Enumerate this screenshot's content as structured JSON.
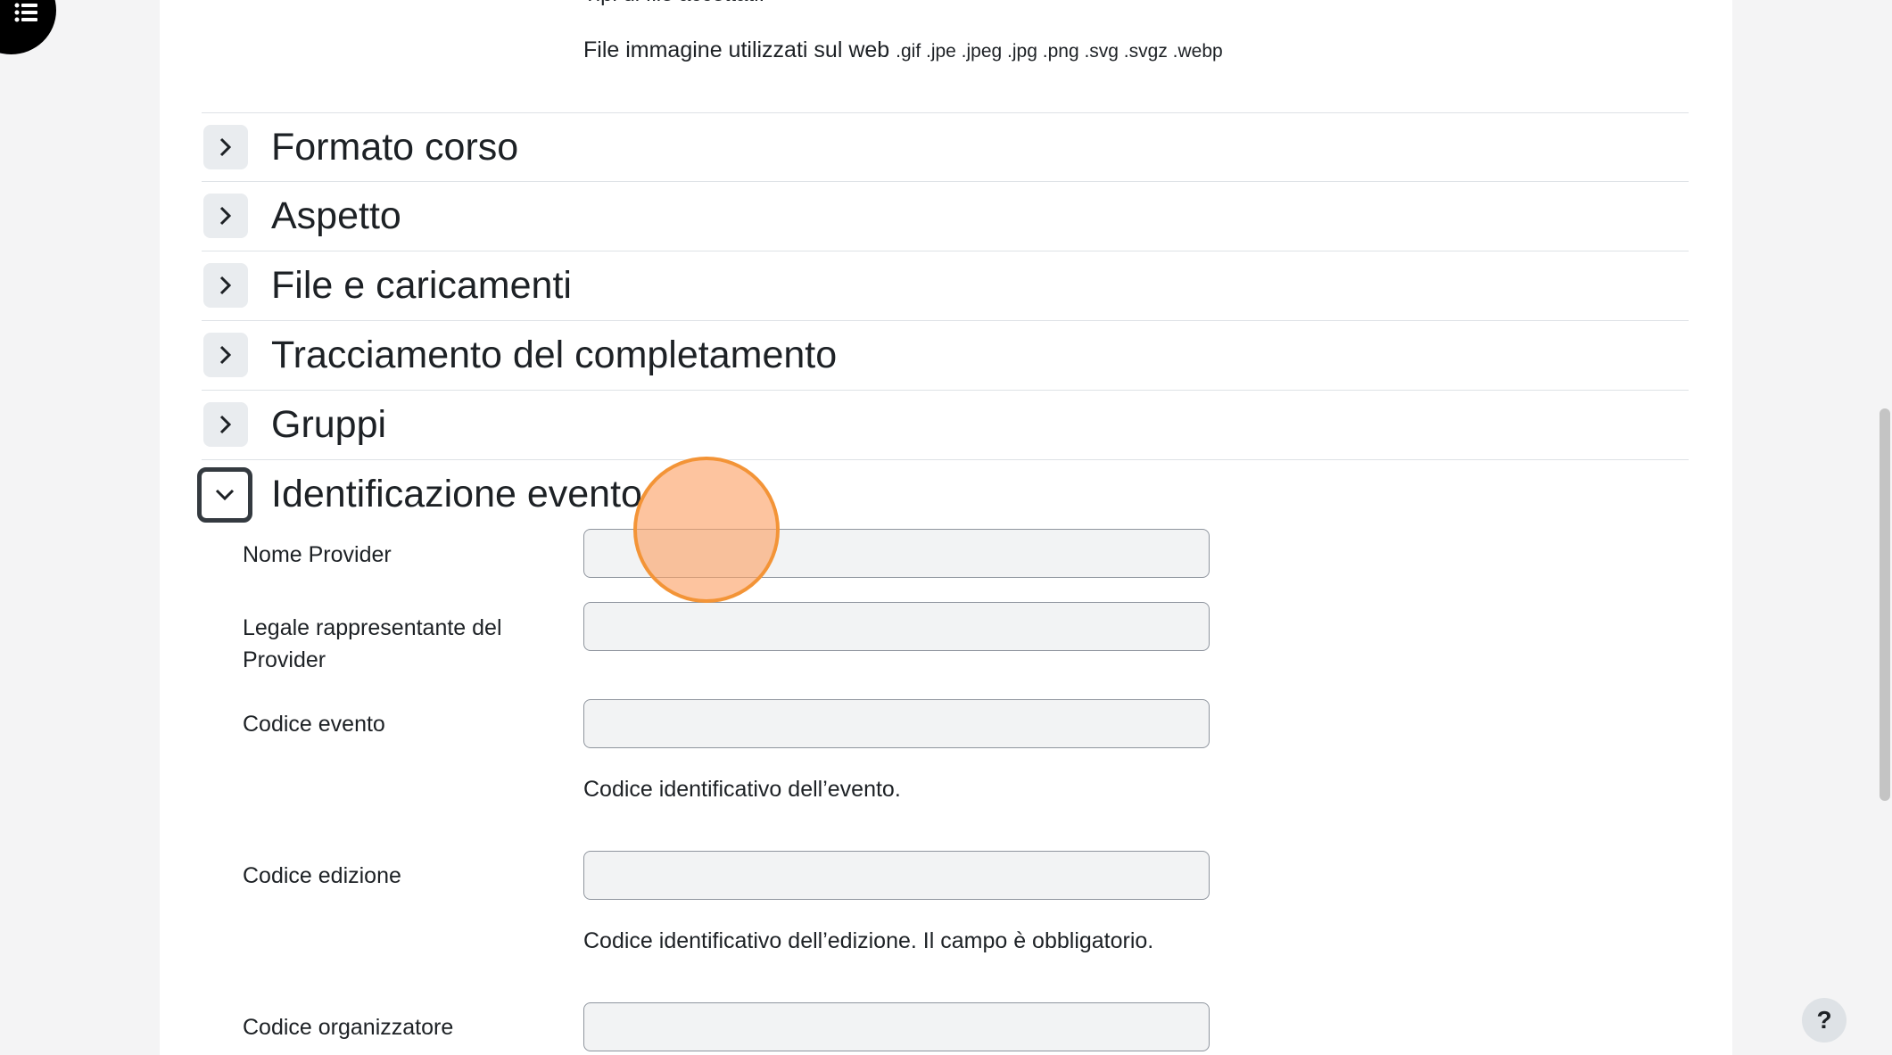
{
  "file_types": {
    "accepted_label": "Tipi di file accettati:",
    "web_images_label": "File immagine utilizzati sul web",
    "web_images_extensions": ".gif .jpe .jpeg .jpg .png .svg .svgz .webp"
  },
  "sections": [
    {
      "title": "Formato corso",
      "expanded": false
    },
    {
      "title": "Aspetto",
      "expanded": false
    },
    {
      "title": "File e caricamenti",
      "expanded": false
    },
    {
      "title": "Tracciamento del completamento",
      "expanded": false
    },
    {
      "title": "Gruppi",
      "expanded": false
    },
    {
      "title": "Identificazione evento",
      "expanded": true
    }
  ],
  "event_fields": {
    "provider_name": {
      "label": "Nome Provider",
      "value": ""
    },
    "legal_rep": {
      "label": "Legale rappresentante del Provider",
      "value": ""
    },
    "event_code": {
      "label": "Codice evento",
      "value": "",
      "help": "Codice identificativo dell’evento."
    },
    "edition_code": {
      "label": "Codice edizione",
      "value": "",
      "help": "Codice identificativo dell’edizione. Il campo è obbligatorio."
    },
    "organizer_code": {
      "label": "Codice organizzatore",
      "value": ""
    }
  },
  "help_button": {
    "label": "?"
  },
  "icons": {
    "drawer": "list-icon",
    "collapsed": "chevron-right-icon",
    "expanded": "chevron-down-icon"
  },
  "colors": {
    "cursor_highlight": "#f39437",
    "input_background": "#f2f3f4",
    "page_background": "#f4f4f5"
  }
}
